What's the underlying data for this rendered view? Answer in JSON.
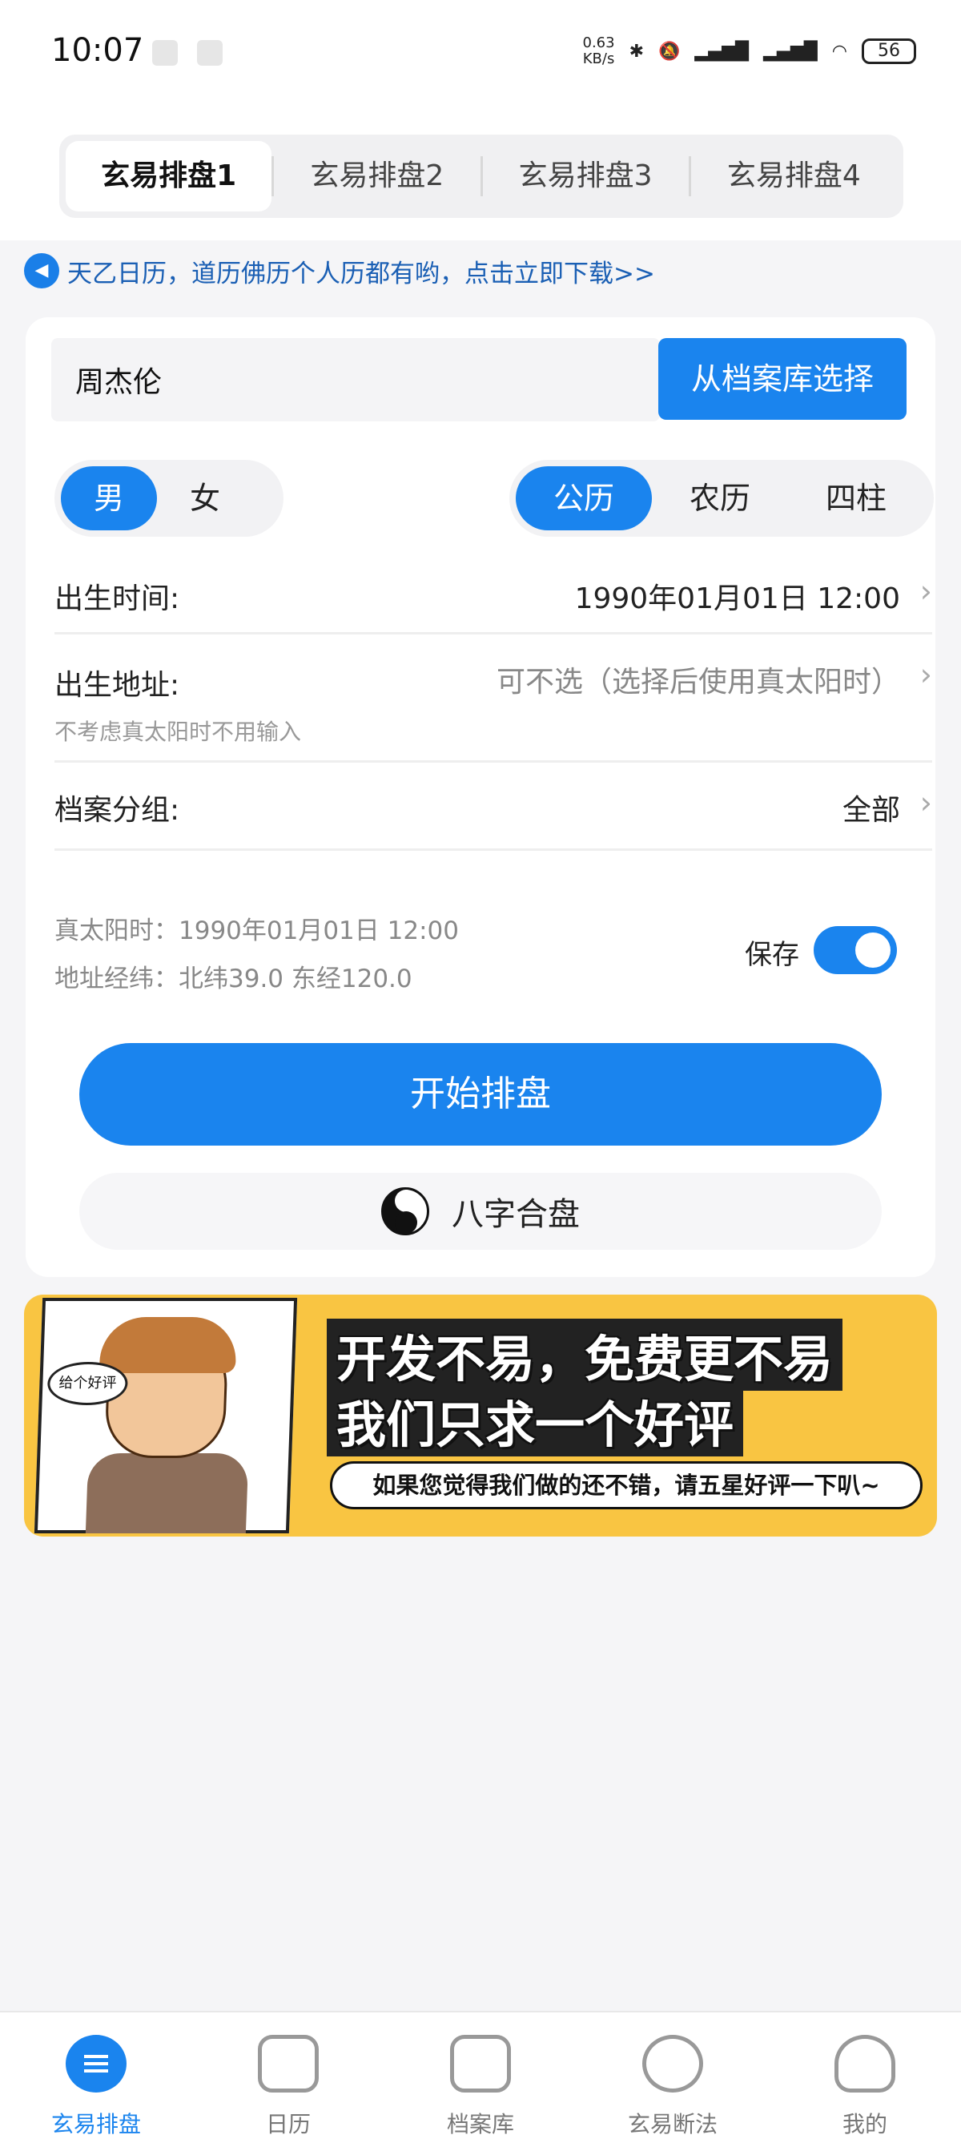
{
  "status_bar": {
    "time": "10:07",
    "net_speed_value": "0.63",
    "net_speed_unit": "KB/s",
    "battery": "56",
    "icons": [
      "notification-icon",
      "notification-icon",
      "bluetooth-icon",
      "mute-icon",
      "signal-icon",
      "signal-icon",
      "wifi-icon",
      "battery-icon"
    ]
  },
  "tabs": [
    {
      "label": "玄易排盘1",
      "active": true
    },
    {
      "label": "玄易排盘2",
      "active": false
    },
    {
      "label": "玄易排盘3",
      "active": false
    },
    {
      "label": "玄易排盘4",
      "active": false
    }
  ],
  "notice": {
    "icon": "speaker-icon",
    "text": "天乙日历，道历佛历个人历都有哟，点击立即下载>>"
  },
  "form": {
    "name_value": "周杰伦",
    "archive_button": "从档案库选择",
    "gender": [
      "男",
      "女"
    ],
    "gender_selected": "男",
    "calendar": [
      "公历",
      "农历",
      "四柱"
    ],
    "calendar_selected": "公历",
    "birth_time_label": "出生时间:",
    "birth_time_value": "1990年01月01日 12:00",
    "birth_place_label": "出生地址:",
    "birth_place_hint": "可不选（选择后使用真太阳时）",
    "birth_place_sub": "不考虑真太阳时不用输入",
    "group_label": "档案分组:",
    "group_value": "全部",
    "solar_time": "真太阳时：1990年01月01日 12:00",
    "coords": "地址经纬：北纬39.0 东经120.0",
    "save_label": "保存",
    "save_on": true,
    "start_button": "开始排盘",
    "hepan_button": "八字合盘"
  },
  "banner": {
    "speech": "给个好评",
    "line1": "开发不易，免费更不易",
    "line2": "我们只求一个好评",
    "sub": "如果您觉得我们做的还不错，请五星好评一下叭~"
  },
  "bottom_nav": [
    {
      "label": "玄易排盘",
      "icon": "paipan-icon",
      "active": true
    },
    {
      "label": "日历",
      "icon": "calendar-icon",
      "active": false
    },
    {
      "label": "档案库",
      "icon": "archive-icon",
      "active": false
    },
    {
      "label": "玄易断法",
      "icon": "bagua-icon",
      "active": false
    },
    {
      "label": "我的",
      "icon": "user-icon",
      "active": false
    }
  ],
  "colors": {
    "accent": "#1a84ee",
    "background": "#f5f5f7",
    "banner": "#f9c542"
  }
}
